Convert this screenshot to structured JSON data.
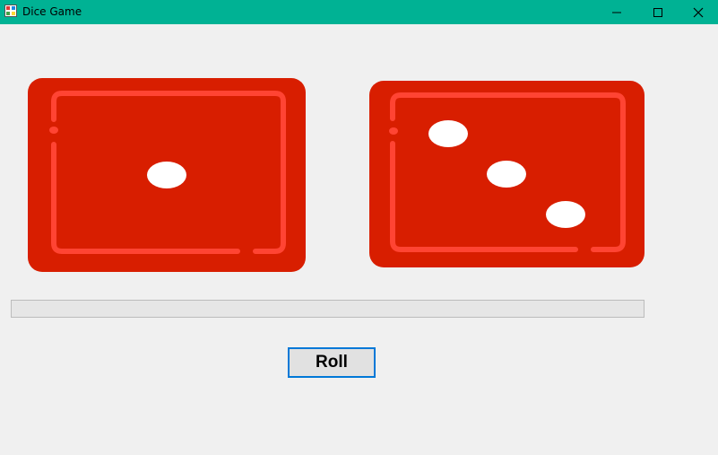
{
  "window": {
    "title": "Dice Game",
    "controls": [
      "minimize",
      "maximize",
      "close"
    ]
  },
  "dice": [
    {
      "face_value": 1,
      "color": "#d81e00"
    },
    {
      "face_value": 3,
      "color": "#d81e00"
    }
  ],
  "progress": {
    "fraction": 0.0
  },
  "actions": {
    "roll_label": "Roll"
  },
  "colors": {
    "titlebar": "#00b294",
    "die_face": "#d81e00",
    "die_border": "#ff4433",
    "pip": "#ffffff",
    "button_focus": "#0078d7"
  }
}
